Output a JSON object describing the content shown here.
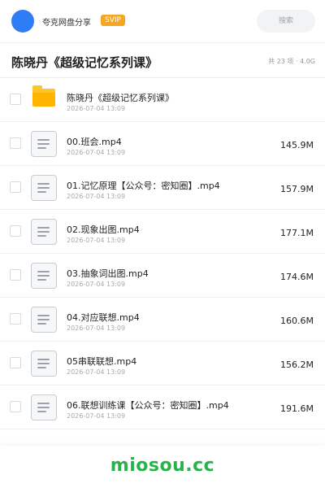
{
  "header": {
    "brand": "夸克网盘分享",
    "badge": "SVIP",
    "search_placeholder": "搜索"
  },
  "folder": {
    "title": "陈晓丹《超级记忆系列课》",
    "summary": "共 23 项 · 4.0G"
  },
  "files": [
    {
      "type": "folder",
      "name": "陈晓丹《超级记忆系列课》",
      "date": "2026-07-04 13:09",
      "size": ""
    },
    {
      "type": "video",
      "name": "00.班会.mp4",
      "date": "2026-07-04 13:09",
      "size": "145.9M"
    },
    {
      "type": "video",
      "name": "01.记忆原理【公众号：密知圈】.mp4",
      "date": "2026-07-04 13:09",
      "size": "157.9M"
    },
    {
      "type": "video",
      "name": "02.现象出图.mp4",
      "date": "2026-07-04 13:09",
      "size": "177.1M"
    },
    {
      "type": "video",
      "name": "03.抽象词出图.mp4",
      "date": "2026-07-04 13:09",
      "size": "174.6M"
    },
    {
      "type": "video",
      "name": "04.对应联想.mp4",
      "date": "2026-07-04 13:09",
      "size": "160.6M"
    },
    {
      "type": "video",
      "name": "05串联联想.mp4",
      "date": "2026-07-04 13:09",
      "size": "156.2M"
    },
    {
      "type": "video",
      "name": "06.联想训练课【公众号：密知圈】.mp4",
      "date": "2026-07-04 13:09",
      "size": "191.6M"
    }
  ],
  "watermark": "miosou.cc",
  "colors": {
    "accent_blue": "#2f7df6",
    "svip_orange": "#f5a623",
    "folder_yellow": "#ffc52e",
    "watermark_green": "#28b34a"
  }
}
